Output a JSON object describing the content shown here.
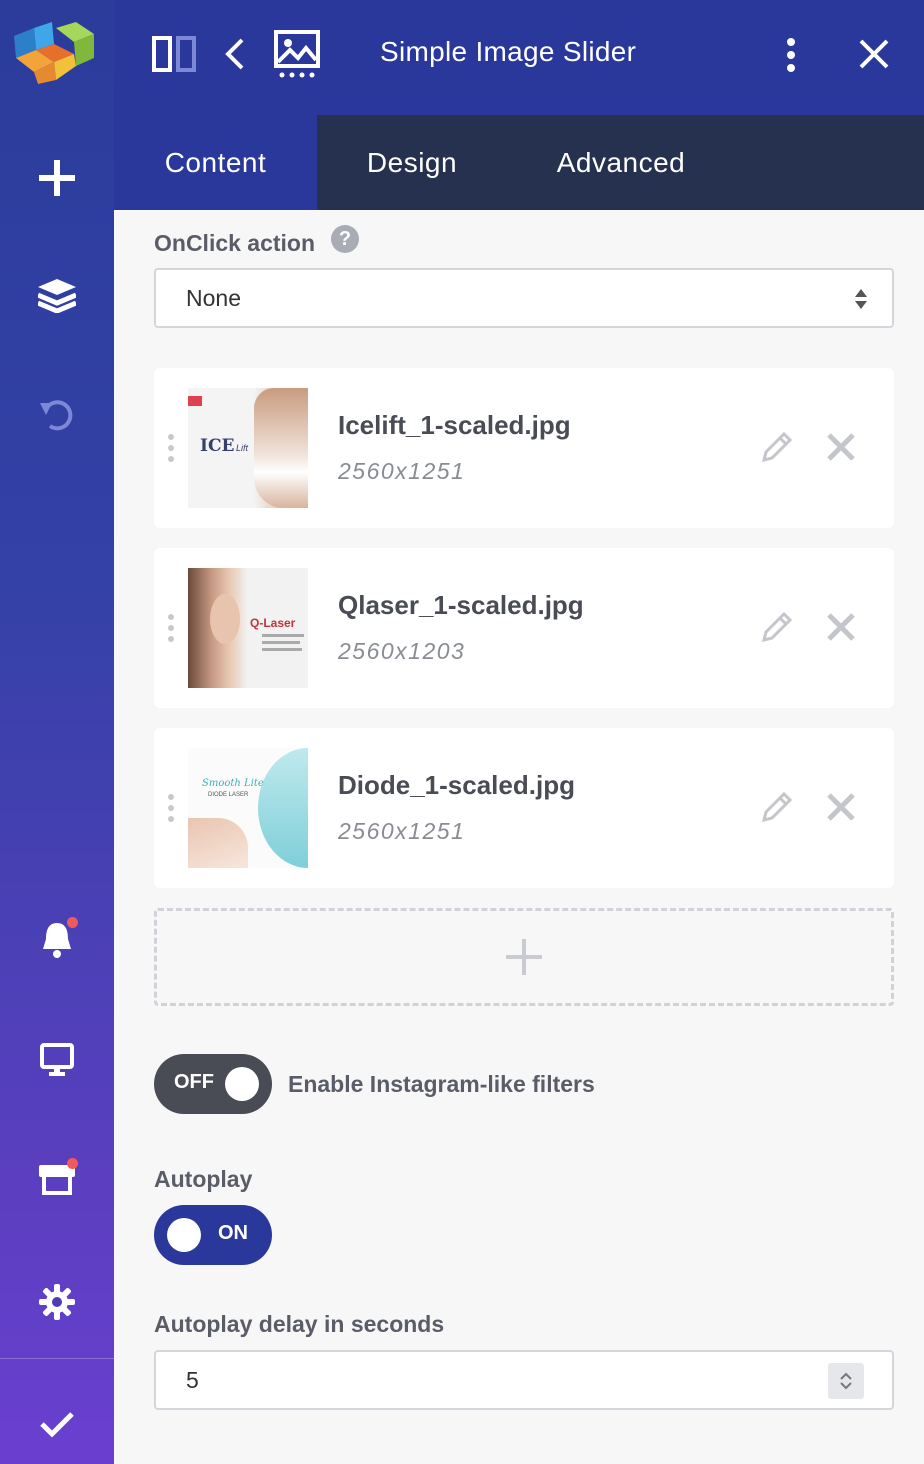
{
  "header": {
    "title": "Simple Image Slider"
  },
  "tabs": [
    {
      "label": "Content",
      "active": true
    },
    {
      "label": "Design",
      "active": false
    },
    {
      "label": "Advanced",
      "active": false
    }
  ],
  "onclick": {
    "label": "OnClick action",
    "help": "?",
    "value": "None"
  },
  "images": [
    {
      "name": "Icelift_1-scaled.jpg",
      "dims": "2560x1251",
      "thumb_text": "ICE",
      "thumb_sub": "Lift"
    },
    {
      "name": "Qlaser_1-scaled.jpg",
      "dims": "2560x1203",
      "thumb_text": "Q-Laser"
    },
    {
      "name": "Diode_1-scaled.jpg",
      "dims": "2560x1251",
      "thumb_text": "Smooth Lite",
      "thumb_sub": "DIODE LASER"
    }
  ],
  "filters": {
    "toggle_text": "OFF",
    "label": "Enable Instagram-like filters",
    "enabled": false
  },
  "autoplay": {
    "label": "Autoplay",
    "toggle_text": "ON",
    "enabled": true
  },
  "delay": {
    "label": "Autoplay delay in seconds",
    "value": "5"
  },
  "colors": {
    "primary": "#29389a",
    "tabbar": "#26314f",
    "toggle_off": "#4a4c55",
    "notify": "#f05a5a"
  }
}
